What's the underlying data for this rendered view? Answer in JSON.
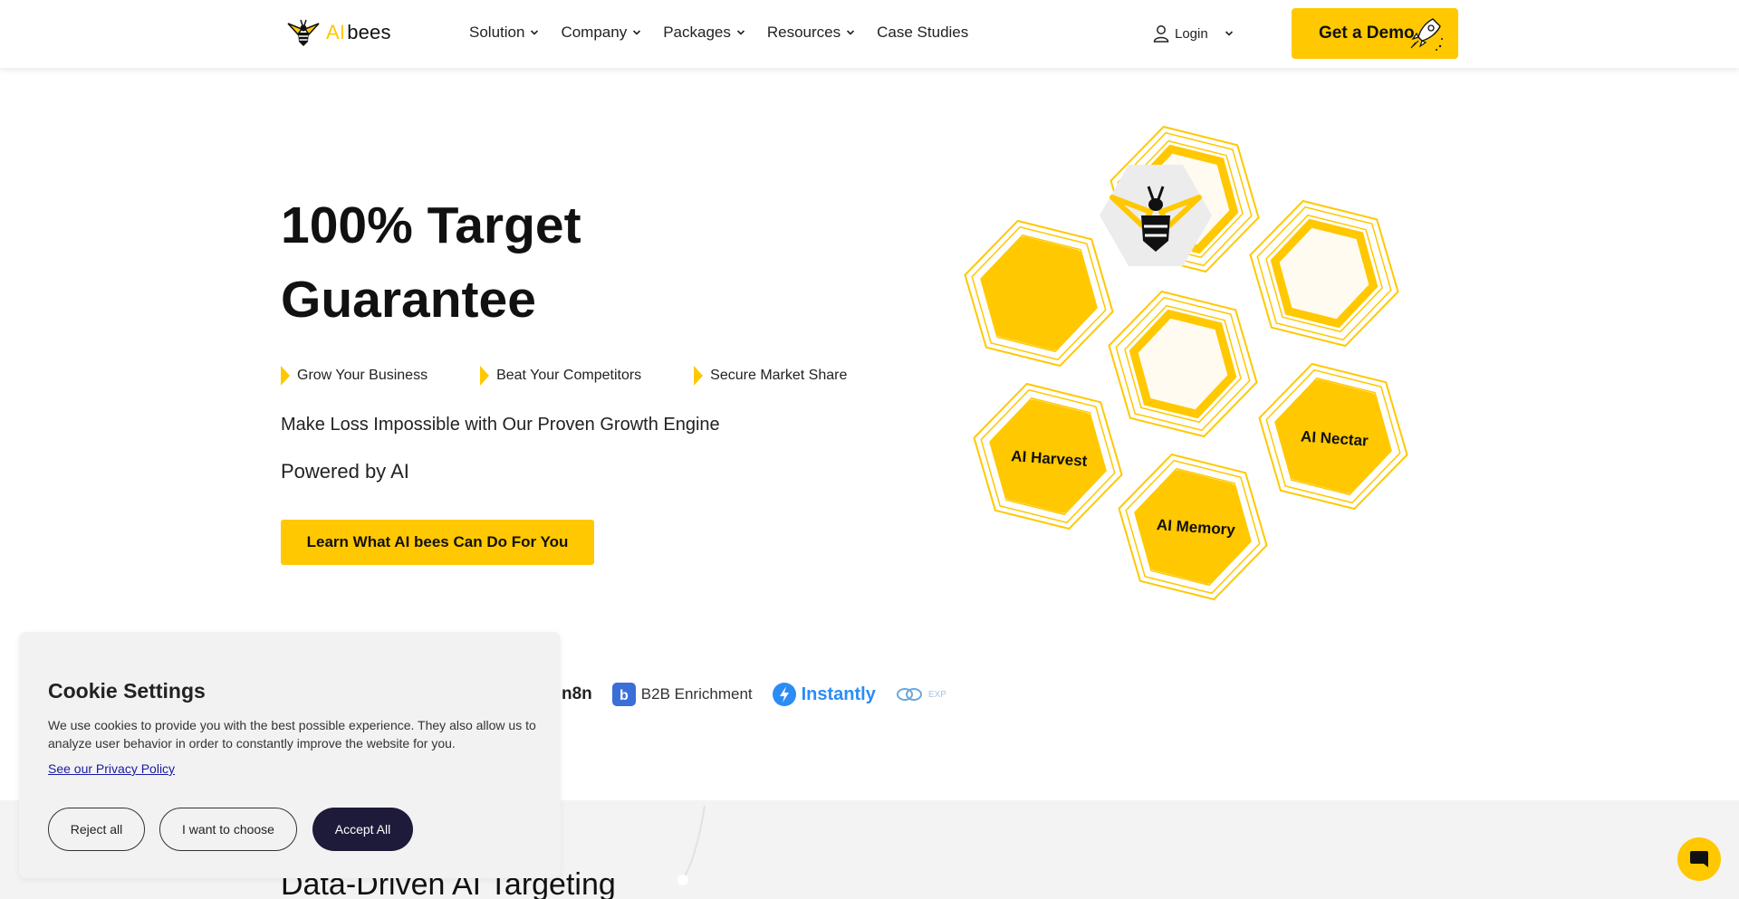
{
  "header": {
    "logo_ai": "AI",
    "logo_bees": "bees",
    "nav": [
      {
        "label": "Solution",
        "dropdown": true
      },
      {
        "label": "Company",
        "dropdown": true
      },
      {
        "label": "Packages",
        "dropdown": true
      },
      {
        "label": "Resources",
        "dropdown": true
      },
      {
        "label": "Case Studies",
        "dropdown": false
      }
    ],
    "login_label": "Login",
    "demo_label": "Get a Demo"
  },
  "hero": {
    "title_line1": "100% Target",
    "title_line2": "Guarantee",
    "bullets": [
      "Grow Your Business",
      "Beat Your Competitors",
      "Secure Market Share"
    ],
    "subtitle1": "Make Loss Impossible with Our Proven Growth Engine",
    "subtitle2": "Powered by AI",
    "cta_label": "Learn What AI bees Can Do For You"
  },
  "honeycomb": {
    "cells": [
      "AI Harvest",
      "AI Nectar",
      "AI Memory"
    ]
  },
  "integrations": [
    {
      "label": "n8n"
    },
    {
      "label": "B2B Enrichment"
    },
    {
      "label": "Instantly"
    },
    {
      "label": "EXP"
    }
  ],
  "section2": {
    "title": "Data-Driven AI Targeting"
  },
  "cookie": {
    "title": "Cookie Settings",
    "text": "We use cookies to provide you with the best possible experience. They also allow us to analyze user behavior in order to constantly improve the website for you.",
    "privacy_link": "See our Privacy Policy",
    "reject_label": "Reject all",
    "choose_label": "I want to choose",
    "accept_label": "Accept All"
  },
  "colors": {
    "brand_yellow": "#ffc800",
    "accept_dark": "#1e1a3a",
    "hex_cream": "#fffbf0"
  },
  "icons": [
    "bee-logo-icon",
    "chevron-down-icon",
    "user-icon",
    "rocket-icon",
    "chat-icon"
  ]
}
